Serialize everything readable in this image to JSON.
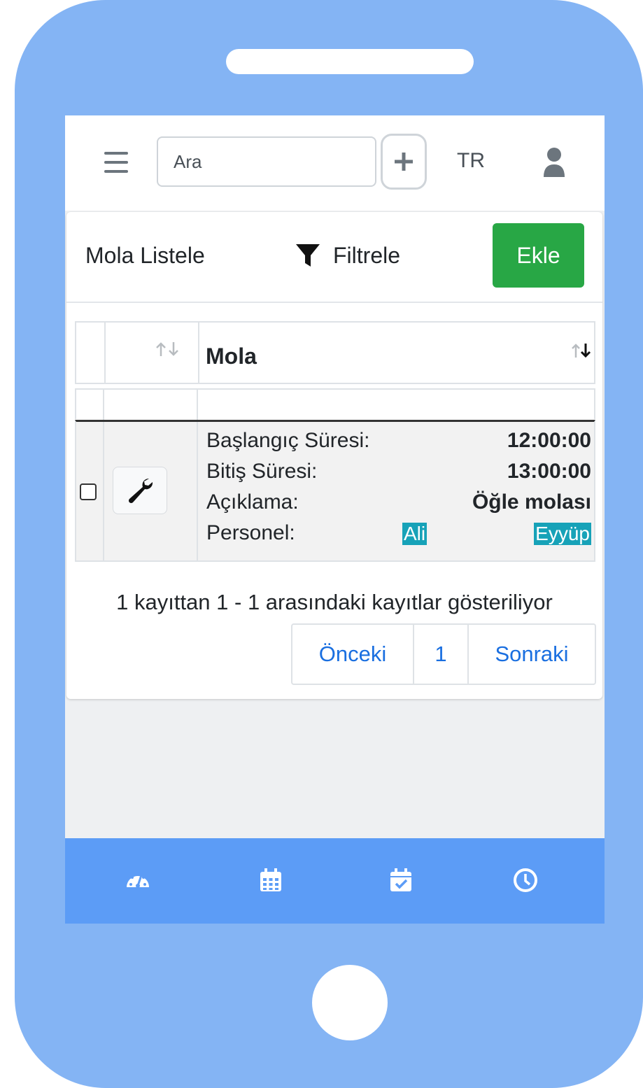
{
  "header": {
    "search_placeholder": "Ara",
    "language": "TR"
  },
  "card": {
    "title": "Mola Listele",
    "filter_label": "Filtrele",
    "add_label": "Ekle"
  },
  "table": {
    "column_header": "Mola",
    "row": {
      "fields": [
        {
          "label": "Başlangıç Süresi:",
          "value": "12:00:00"
        },
        {
          "label": "Bitiş Süresi:",
          "value": "13:00:00"
        },
        {
          "label": "Açıklama:",
          "value": "Öğle molası"
        }
      ],
      "personnel_label": "Personel:",
      "personnel": [
        "Ali",
        "Eyyüp"
      ]
    }
  },
  "pagination": {
    "info": "1 kayıttan 1 - 1 arasındaki kayıtlar gösteriliyor",
    "prev": "Önceki",
    "page": "1",
    "next": "Sonraki"
  },
  "colors": {
    "phone_body": "#84b4f4",
    "bottom_nav": "#5c9cf6",
    "add_button": "#28a745",
    "badge": "#17a2b8",
    "link": "#1a6fe0"
  },
  "icons": {
    "menu": "hamburger-icon",
    "add": "plus-icon",
    "user": "user-icon",
    "filter": "filter-icon",
    "edit": "wrench-icon",
    "nav": [
      "dashboard-icon",
      "calendar-icon",
      "calendar-check-icon",
      "clock-icon"
    ]
  }
}
